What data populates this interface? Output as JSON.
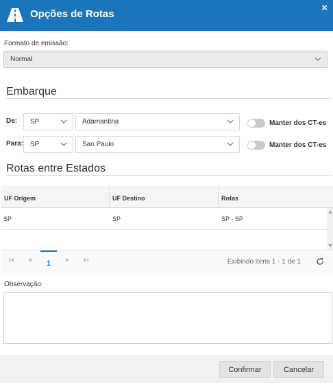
{
  "dialog": {
    "title": "Opções de Rotas",
    "close_label": "×"
  },
  "formato": {
    "label": "Formato de emissão:",
    "value": "Normal"
  },
  "embarque": {
    "title": "Embarque",
    "de": {
      "label": "De:",
      "uf": "SP",
      "city": "Adamantina",
      "toggle_label": "Manter dos CT-es"
    },
    "para": {
      "label": "Para:",
      "uf": "SP",
      "city": "Sao Paulo",
      "toggle_label": "Manter dos CT-es"
    }
  },
  "rotas": {
    "title": "Rotas entre Estados",
    "columns": [
      "UF Origem",
      "UF Destino",
      "Rotas"
    ],
    "rows": [
      [
        "SP",
        "SP",
        "SP - SP"
      ]
    ],
    "pager": {
      "page": "1",
      "info": "Exibindo itens 1 - 1 de 1"
    }
  },
  "observacao": {
    "label": "Observação:",
    "value": ""
  },
  "footer": {
    "confirm_label": "Confirmar",
    "cancel_label": "Cancelar"
  },
  "colors": {
    "header": "#1b75bb",
    "toggle_off": "#c9c9c9",
    "button": "#e3e3e3"
  }
}
